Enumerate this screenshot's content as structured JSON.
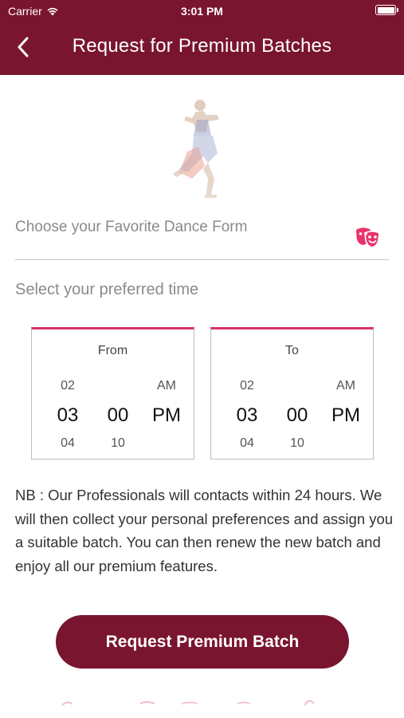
{
  "status_bar": {
    "carrier": "Carrier",
    "time": "3:01 PM"
  },
  "header": {
    "title": "Request for Premium Batches",
    "back_icon": "chevron-left-icon"
  },
  "dance_form": {
    "placeholder": "Choose your Favorite Dance Form",
    "icon": "theater-mask-icon",
    "icon_color": "#e8336a"
  },
  "time_section": {
    "label": "Select your preferred time"
  },
  "from_picker": {
    "title": "From",
    "prev": {
      "hour": "02",
      "minute": "",
      "period": "AM"
    },
    "selected": {
      "hour": "03",
      "minute": "00",
      "period": "PM"
    },
    "next": {
      "hour": "04",
      "minute": "10",
      "period": ""
    }
  },
  "to_picker": {
    "title": "To",
    "prev": {
      "hour": "02",
      "minute": "",
      "period": "AM"
    },
    "selected": {
      "hour": "03",
      "minute": "00",
      "period": "PM"
    },
    "next": {
      "hour": "04",
      "minute": "10",
      "period": ""
    }
  },
  "note": "NB : Our Professionals will contacts within 24 hours. We will then collect your personal preferences and assign you a suitable batch. You can then renew the new batch and enjoy all our premium features.",
  "request_button": {
    "label": "Request Premium Batch"
  },
  "colors": {
    "brand": "#7a1530",
    "accent": "#d6336c"
  }
}
